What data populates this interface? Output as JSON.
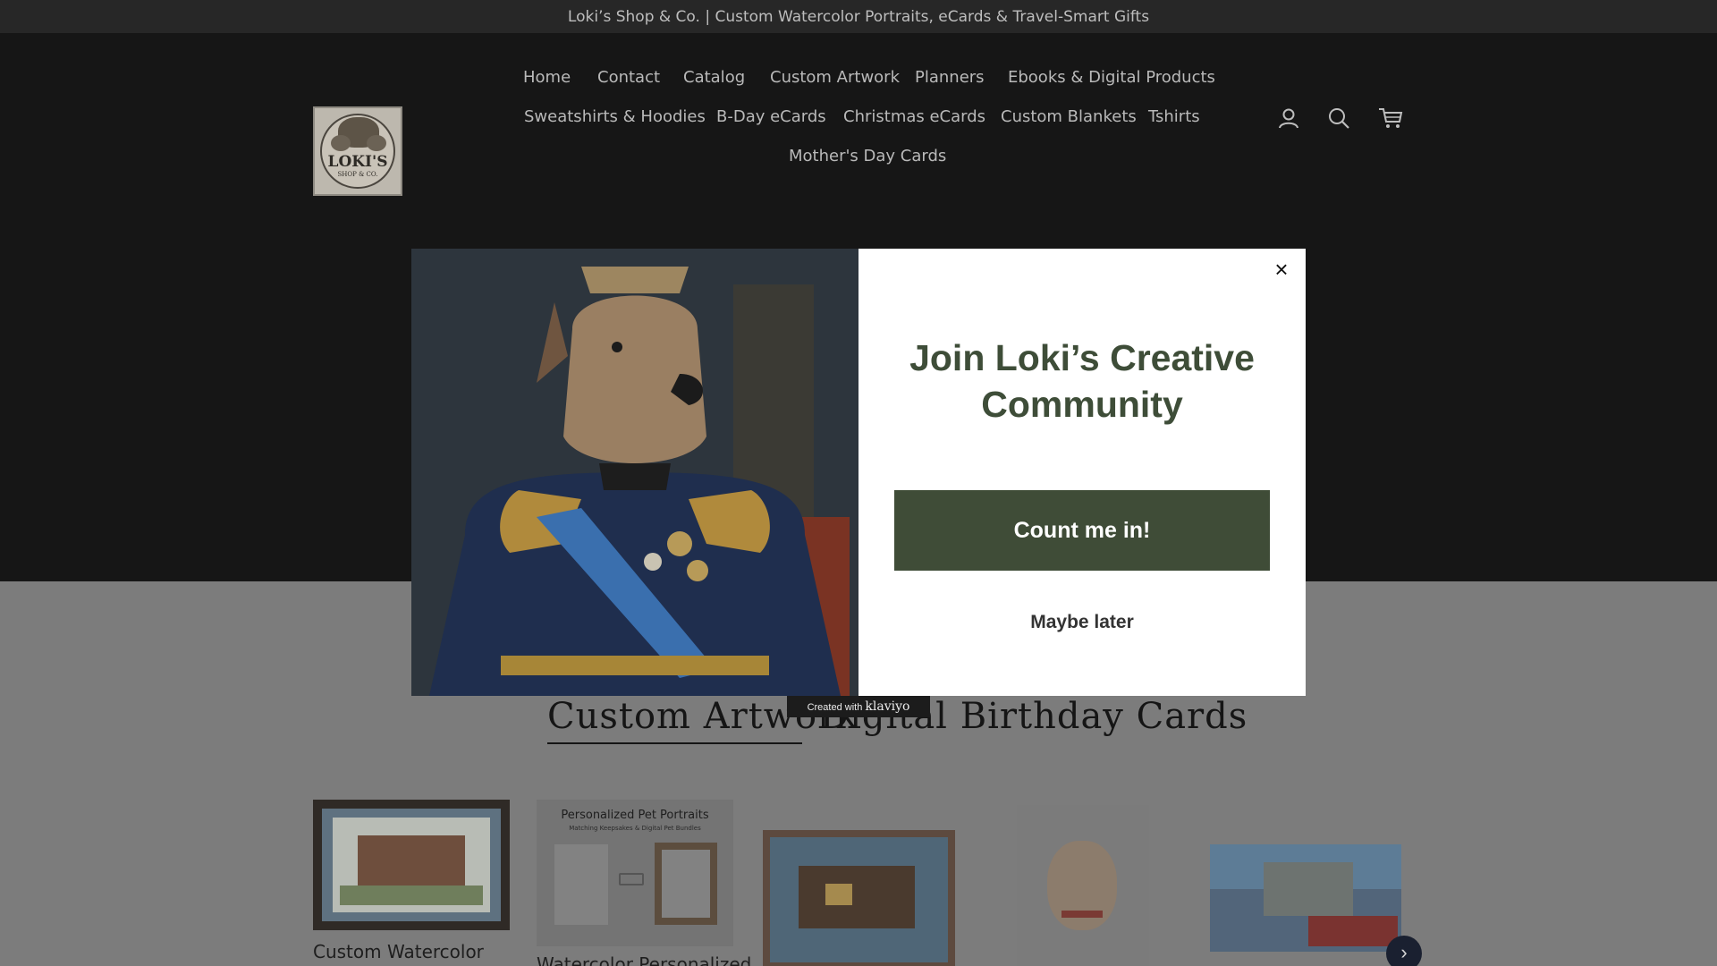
{
  "announcement": "Loki’s Shop & Co. | Custom Watercolor Portraits, eCards & Travel-Smart Gifts",
  "logo": {
    "name": "LOKI'S",
    "sub": "SHOP & CO."
  },
  "nav": {
    "row1": [
      "Home",
      "Contact",
      "Catalog",
      "Custom Artwork",
      "Planners",
      "Ebooks & Digital Products"
    ],
    "row2": [
      "Sweatshirts & Hoodies",
      "B-Day eCards",
      "Christmas eCards",
      "Custom Blankets",
      "Tshirts"
    ],
    "row3": [
      "Mother's Day Cards"
    ]
  },
  "header_icons": [
    "account-icon",
    "search-icon",
    "cart-icon"
  ],
  "collection_tabs": {
    "active": "Custom Artwork",
    "inactive": "Digital Birthday Cards"
  },
  "products": [
    {
      "title": "Custom Watercolor"
    },
    {
      "title": "Watercolor Personalized",
      "image_heading": "Personalized Pet Portraits",
      "image_subheading": "Matching Keepsakes & Digital Pet Bundles"
    }
  ],
  "modal": {
    "heading": "Join Loki’s Creative Community",
    "cta": "Count me in!",
    "dismiss": "Maybe later",
    "close": "×"
  },
  "badge": {
    "prefix": "Created with",
    "brand": "klaviyo"
  },
  "colors": {
    "modal_accent": "#3f4c37",
    "heading": "#3e4d38"
  }
}
